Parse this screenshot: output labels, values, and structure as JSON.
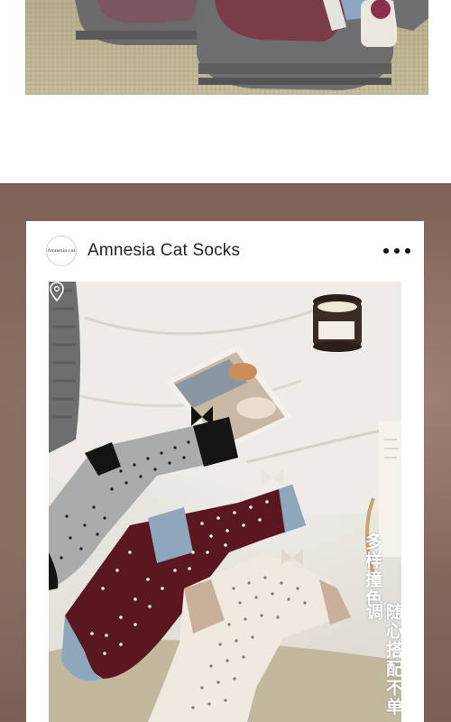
{
  "card": {
    "avatar_text": "Amnesia cat",
    "brand_name": "Amnesia Cat Socks",
    "more_icon": "more-dots-icon"
  },
  "photo": {
    "slogan_line1": "多样撞色",
    "slogan_line2": "随心搭配不单调",
    "pin_icon": "location-pin-icon",
    "candle_label": ""
  },
  "colors": {
    "background_band": "#7e6257",
    "card_bg": "#ffffff",
    "sock_gray": "#a9abac",
    "sock_burgundy": "#5b1720",
    "sock_cream": "#efe9df",
    "accent_blue": "#8ea7bd",
    "accent_tan": "#c8b09a"
  }
}
